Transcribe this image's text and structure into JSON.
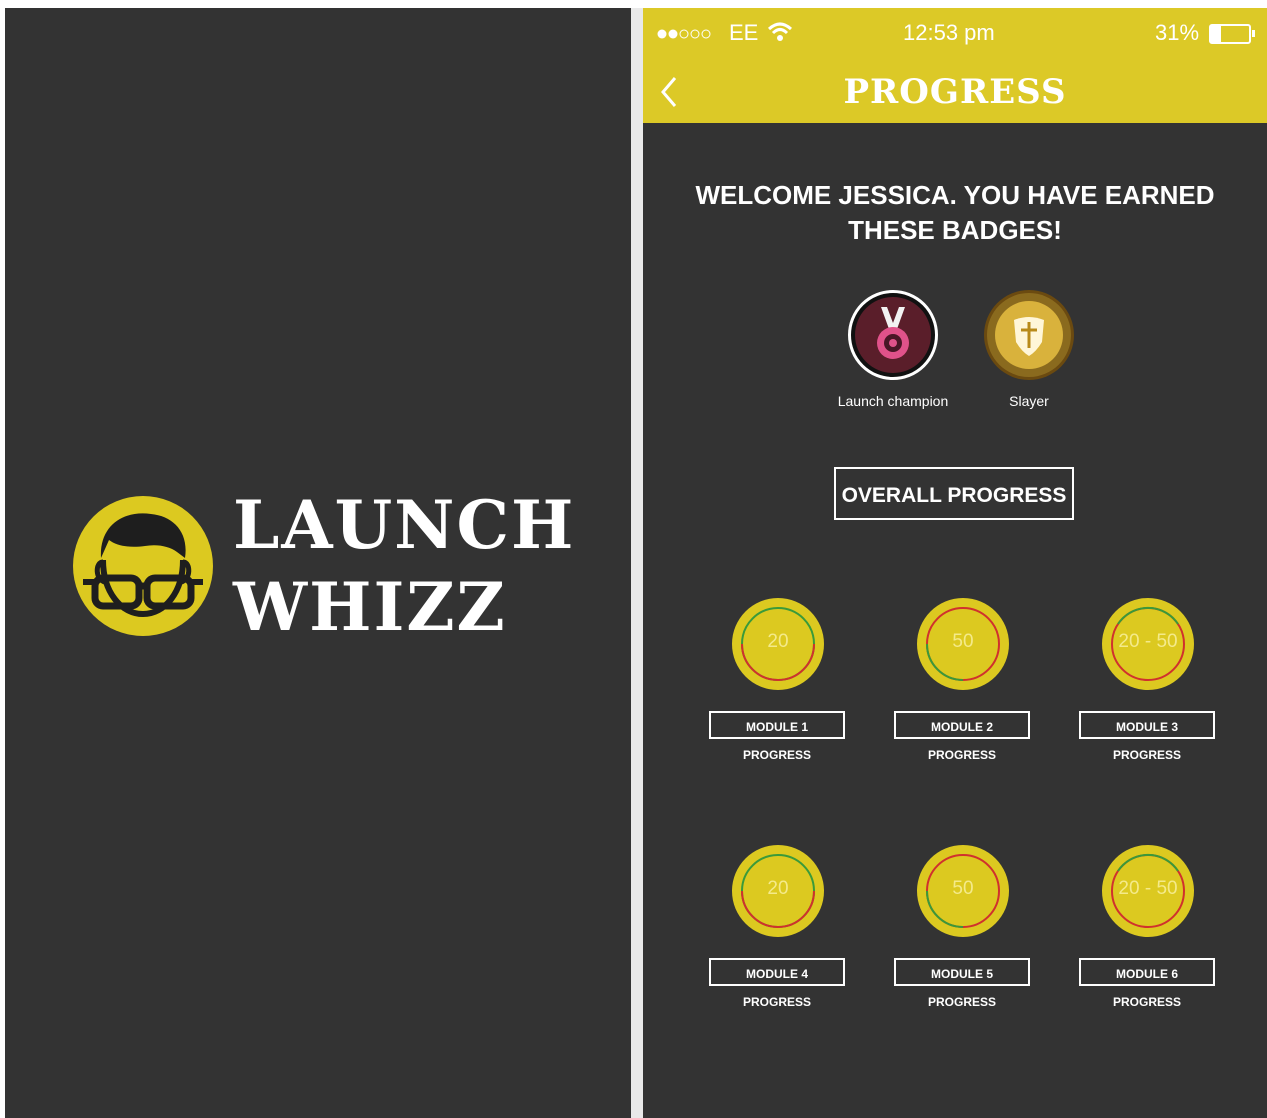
{
  "splash": {
    "logo_line1": "LAUNCH",
    "logo_line2": "WHIZZ",
    "brand_color": "#dcc920"
  },
  "status_bar": {
    "carrier": "EE",
    "time": "12:53 pm",
    "battery": "31%"
  },
  "header": {
    "title": "PROGRESS",
    "back_icon": "chevron-left-icon"
  },
  "welcome": {
    "line1": "WELCOME JESSICA. YOU HAVE EARNED",
    "line2": "THESE BADGES!"
  },
  "badges": [
    {
      "label": "Launch champion",
      "icon": "medal-icon"
    },
    {
      "label": "Slayer",
      "icon": "shield-icon"
    }
  ],
  "overall_button": "OVERALL PROGRESS",
  "modules": [
    {
      "ring_text": "20",
      "label": "MODULE 1 PROGRESS"
    },
    {
      "ring_text": "50",
      "label": "MODULE 2 PROGRESS"
    },
    {
      "ring_text": "20 - 50",
      "label": "MODULE 3 PROGRESS"
    },
    {
      "ring_text": "20",
      "label": "MODULE 4 PROGRESS"
    },
    {
      "ring_text": "50",
      "label": "MODULE 5 PROGRESS"
    },
    {
      "ring_text": "20 - 50",
      "label": "MODULE 6 PROGRESS"
    }
  ],
  "colors": {
    "header": "#dcc927",
    "background": "#333333",
    "ring_green": "#3a9a3a",
    "ring_red": "#d0312d"
  }
}
